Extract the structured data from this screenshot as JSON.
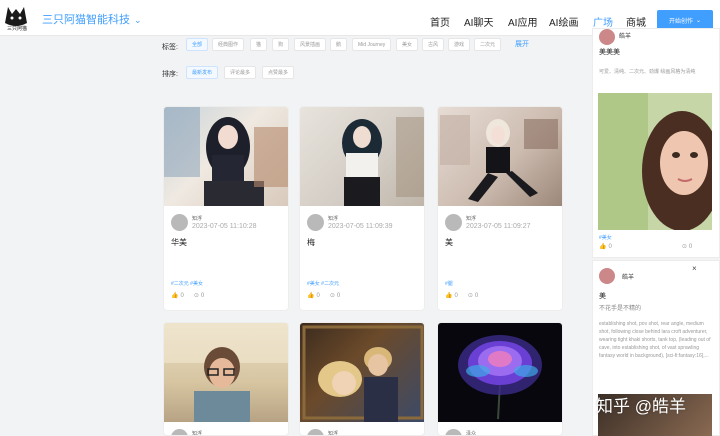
{
  "header": {
    "logo_caption": "三只阿猫",
    "brand": "三只阿猫智能科技",
    "nav": [
      "首页",
      "AI聊天",
      "AI应用",
      "AI绘画",
      "广场",
      "商城"
    ],
    "active_nav": "广场",
    "cta_label": "开始创作"
  },
  "filters": {
    "tags_label": "标签:",
    "tags": [
      "全部",
      "经典图作",
      "猫",
      "狗",
      "风景插画",
      "鹅",
      "Mid Journey",
      "美女",
      "古风",
      "游戏",
      "二次元"
    ],
    "expand_label": "展开",
    "sort_label": "排序:",
    "sorts": [
      "最新发布",
      "评论最多",
      "点赞最多"
    ]
  },
  "cards": [
    {
      "author": "知浮",
      "date": "2023-07-05 11:10:28",
      "title": "华美",
      "tags": "#二次元 #美女",
      "likes": "0",
      "comments": "0"
    },
    {
      "author": "知浮",
      "date": "2023-07-05 11:09:39",
      "title": "梅",
      "tags": "#美女 #二次元",
      "likes": "0",
      "comments": "0"
    },
    {
      "author": "知浮",
      "date": "2023-07-05 11:09:27",
      "title": "美",
      "tags": "#腿",
      "likes": "0",
      "comments": "0"
    },
    {
      "author": "知浮"
    },
    {
      "author": "知浮"
    },
    {
      "author": "泽众"
    }
  ],
  "right": {
    "top_name": "皓羊",
    "top_title": "美美美",
    "top_text": "可爱、清纯、二次元、劲爆 绘画风格为清纯",
    "top_tags": "#美女",
    "top_likes": "0",
    "top_comments": "0",
    "bottom_name": "皓羊",
    "bottom_title": "美",
    "bottom_sub": "不花手是不精的",
    "bottom_text": "establishing shot, pov shot, rear angle, medium shot, following close behind lara croft adventurer, wearing tight khaki shorts, tank top, (leading out of cave, into establishing shot, of vast sprawling fantasy world in background), [sci-fi:fantasy:16],...",
    "close": "×"
  },
  "watermark": "知乎 @皓羊",
  "colors": {
    "accent": "#409eff",
    "background": "#f2f3f5",
    "card": "#ffffff"
  }
}
